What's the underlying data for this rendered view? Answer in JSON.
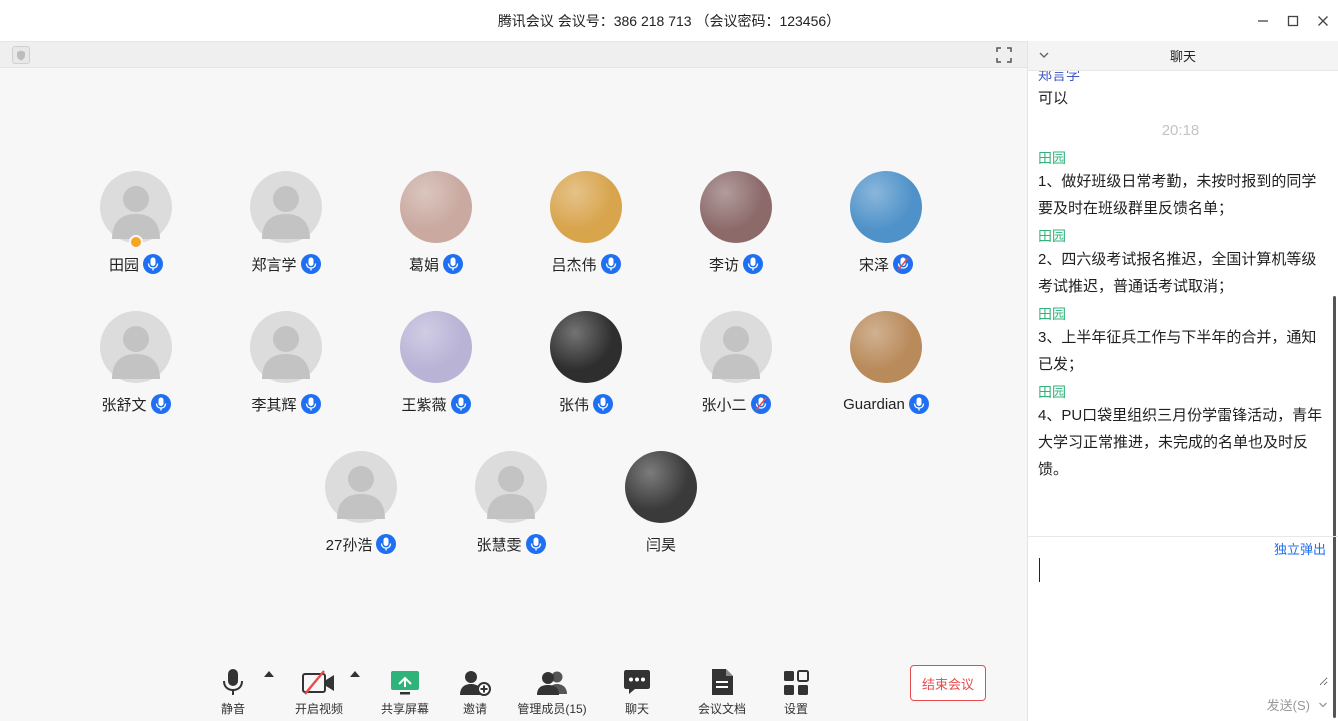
{
  "window": {
    "title": "腾讯会议 会议号：386 218 713 （会议密码：123456）"
  },
  "participants": [
    {
      "name": "田园",
      "avatar": "default",
      "mic": "on",
      "host": true
    },
    {
      "name": "郑言学",
      "avatar": "default",
      "mic": "on"
    },
    {
      "name": "葛娟",
      "avatar": "photo",
      "mic": "on",
      "color": "#c9a9a0"
    },
    {
      "name": "吕杰伟",
      "avatar": "photo",
      "mic": "on",
      "color": "#d8a44c"
    },
    {
      "name": "李访",
      "avatar": "photo",
      "mic": "on",
      "color": "#8c6a6a"
    },
    {
      "name": "宋泽",
      "avatar": "photo",
      "mic": "muted",
      "color": "#4f92c9"
    },
    {
      "name": "张舒文",
      "avatar": "default",
      "mic": "on"
    },
    {
      "name": "李其辉",
      "avatar": "default",
      "mic": "on"
    },
    {
      "name": "王紫薇",
      "avatar": "photo",
      "mic": "on",
      "color": "#b9b3d6"
    },
    {
      "name": "张伟",
      "avatar": "photo",
      "mic": "on",
      "color": "#2e2e2e"
    },
    {
      "name": "张小二",
      "avatar": "default",
      "mic": "muted"
    },
    {
      "name": "Guardian",
      "avatar": "photo",
      "mic": "on",
      "color": "#b98a5a"
    },
    {
      "name": "27孙浩",
      "avatar": "default",
      "mic": "on"
    },
    {
      "name": "张慧雯",
      "avatar": "default",
      "mic": "on"
    },
    {
      "name": "闫昊",
      "avatar": "photo",
      "mic": "none",
      "color": "#3a3a3a"
    }
  ],
  "toolbar": {
    "mute": "静音",
    "video": "开启视频",
    "share": "共享屏幕",
    "invite": "邀请",
    "members": "管理成员(15)",
    "chat": "聊天",
    "docs": "会议文档",
    "settings": "设置",
    "end": "结束会议"
  },
  "chat": {
    "header": "聊天",
    "messages": [
      {
        "sender": "郑言学",
        "sender_color": "#3b55c5",
        "text": "可以"
      },
      {
        "time": "20:18"
      },
      {
        "sender": "田园",
        "sender_color": "#2fb37a",
        "text": "1、做好班级日常考勤，未按时报到的同学要及时在班级群里反馈名单；"
      },
      {
        "sender": "田园",
        "sender_color": "#2fb37a",
        "text": "2、四六级考试报名推迟，全国计算机等级考试推迟，普通话考试取消；"
      },
      {
        "sender": "田园",
        "sender_color": "#2fb37a",
        "text": "3、上半年征兵工作与下半年的合并，通知已发；"
      },
      {
        "sender": "田园",
        "sender_color": "#2fb37a",
        "text": "4、PU口袋里组织三月份学雷锋活动，青年大学习正常推进，未完成的名单也及时反馈。"
      }
    ],
    "popout": "独立弹出",
    "input_value": "",
    "send": "发送(S)"
  }
}
